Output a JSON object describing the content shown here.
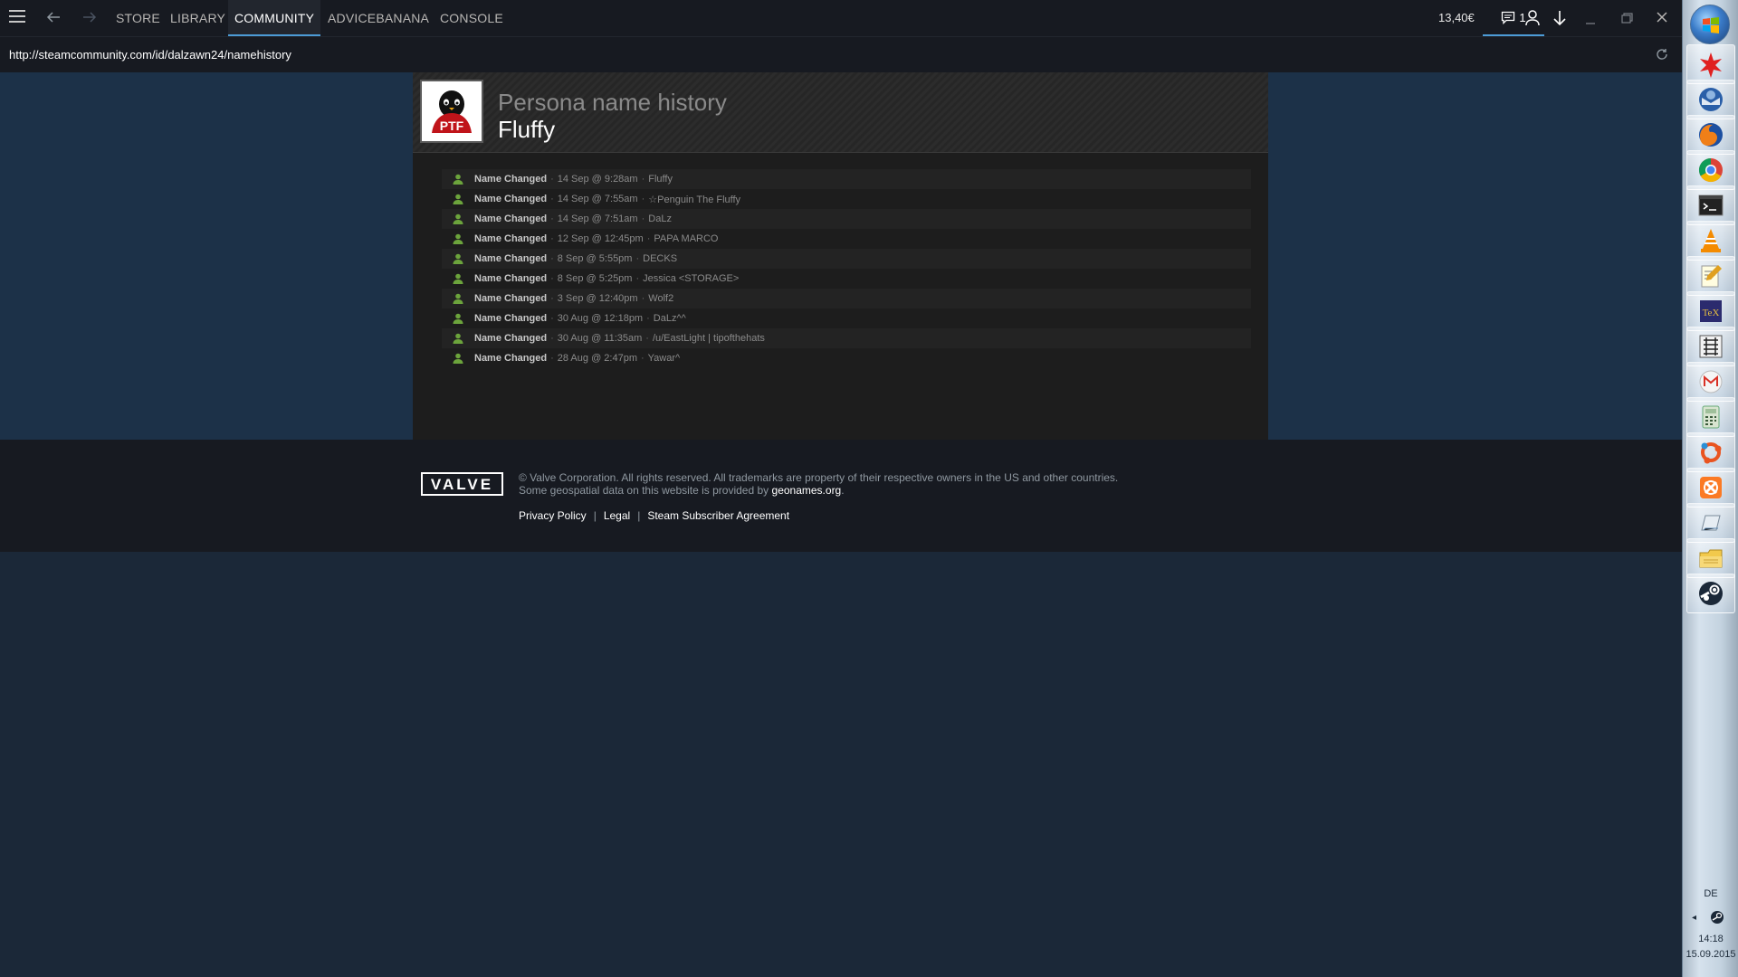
{
  "titlebar": {
    "nav_tabs": [
      {
        "label": "STORE"
      },
      {
        "label": "LIBRARY"
      },
      {
        "label": "COMMUNITY"
      },
      {
        "label": "ADVICEBANANA"
      },
      {
        "label": "CONSOLE"
      }
    ],
    "wallet": "13,40€",
    "notification_count": "1",
    "active_tab": "COMMUNITY"
  },
  "urlbar": {
    "url": "http://steamcommunity.com/id/dalzawn24/namehistory"
  },
  "profile": {
    "page_heading": "Persona name history",
    "persona_name": "Fluffy",
    "avatar_text": "PTF"
  },
  "history": [
    {
      "label": "Name Changed",
      "date": "14 Sep @ 9:28am",
      "value": "Fluffy"
    },
    {
      "label": "Name Changed",
      "date": "14 Sep @ 7:55am",
      "value": "☆Penguin The Fluffy"
    },
    {
      "label": "Name Changed",
      "date": "14 Sep @ 7:51am",
      "value": "DaLz"
    },
    {
      "label": "Name Changed",
      "date": "12 Sep @ 12:45pm",
      "value": "PAPA MARCO"
    },
    {
      "label": "Name Changed",
      "date": "8 Sep @ 5:55pm",
      "value": "DECKS"
    },
    {
      "label": "Name Changed",
      "date": "8 Sep @ 5:25pm",
      "value": "Jessica <STORAGE>"
    },
    {
      "label": "Name Changed",
      "date": "3 Sep @ 12:40pm",
      "value": "Wolf2"
    },
    {
      "label": "Name Changed",
      "date": "30 Aug @ 12:18pm",
      "value": "DaLz^^"
    },
    {
      "label": "Name Changed",
      "date": "30 Aug @ 11:35am",
      "value": "/u/EastLight | tipofthehats"
    },
    {
      "label": "Name Changed",
      "date": "28 Aug @ 2:47pm",
      "value": "Yawar^"
    }
  ],
  "footer": {
    "logo_text": "VALVE",
    "copyright": "© Valve Corporation. All rights reserved. All trademarks are property of their respective owners in the US and other countries.",
    "geo_text": "Some geospatial data on this website is provided by",
    "geo_link": "geonames.org",
    "geo_suffix": ".",
    "links": [
      "Privacy Policy",
      "Legal",
      "Steam Subscriber Agreement"
    ],
    "link_divider": "|"
  },
  "taskbar": {
    "apps": [
      "paint-splash-icon",
      "thunderbird-icon",
      "firefox-icon",
      "chrome-icon",
      "terminal-icon",
      "vlc-icon",
      "notepad-icon",
      "texworks-icon",
      "kanji-icon",
      "gmail-icon",
      "calculator-icon",
      "ubuntu-icon",
      "xampp-icon",
      "notebook-icon",
      "file-explorer-icon",
      "steam-icon"
    ],
    "language": "DE",
    "time": "14:18",
    "date": "15.09.2015"
  },
  "colors": {
    "accent": "#4c9bd6",
    "history_icon": "#6ca43c",
    "background": "#1b2838"
  }
}
